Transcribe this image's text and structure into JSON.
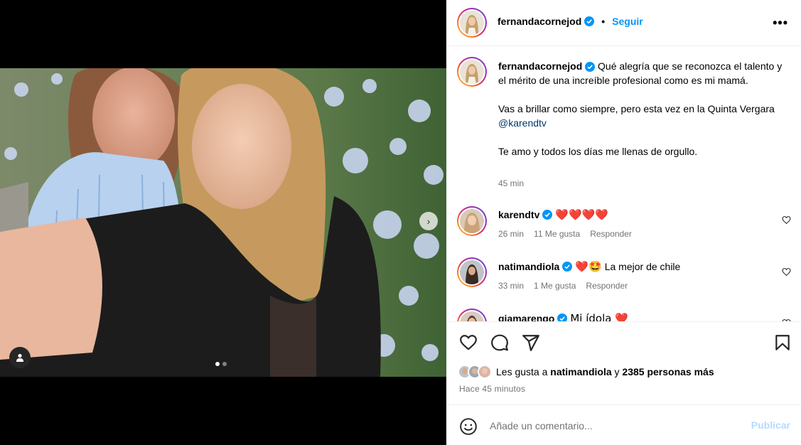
{
  "post": {
    "author": "fernandacornejod",
    "follow_label": "Seguir",
    "separator": "•",
    "more_label": "•••",
    "carousel": {
      "total": 2,
      "current": 1
    },
    "caption": {
      "line1": "Qué alegría que se reconozca el talento y el mérito de una increíble profesional como es mi mamá.",
      "line2_pre": "Vas a brillar como siempre, pero esta vez en la Quinta Vergara ",
      "line2_mention": "@karendtv",
      "line3": "Te amo y todos los días me llenas de orgullo.",
      "time": "45 min"
    },
    "comments": [
      {
        "user": "karendtv",
        "text": "❤️❤️❤️❤️",
        "time": "26 min",
        "likes": "11 Me gusta",
        "reply": "Responder"
      },
      {
        "user": "natimandiola",
        "text_pre": "❤️🤩",
        "text": "La mejor de chile",
        "time": "33 min",
        "likes": "1 Me gusta",
        "reply": "Responder"
      },
      {
        "user": "giamarengo",
        "text": "Mi ídola ❤️"
      }
    ],
    "likes": {
      "prefix": "Les gusta a",
      "user": "natimandiola",
      "connector": "y",
      "others": "2385 personas más"
    },
    "posted": "Hace 45 minutos"
  },
  "add_comment": {
    "placeholder": "Añade un comentario...",
    "publish_label": "Publicar"
  },
  "colors": {
    "accent": "#0095f6",
    "meta": "#737373",
    "heart": "#ed4956",
    "publish_disabled": "#b3dbff"
  }
}
